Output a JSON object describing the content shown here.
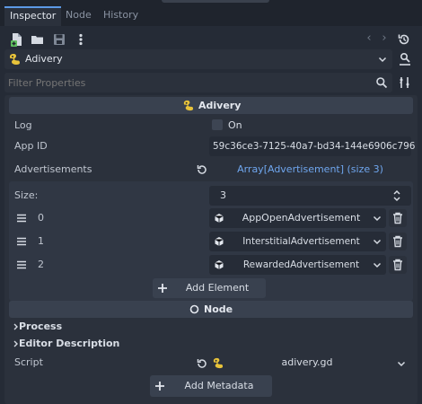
{
  "tabs": [
    {
      "label": "Inspector",
      "active": true
    },
    {
      "label": "Node",
      "active": false
    },
    {
      "label": "History",
      "active": false
    }
  ],
  "object_selector": {
    "name": "Adivery"
  },
  "filter": {
    "placeholder": "Filter Properties"
  },
  "class_header": {
    "label": "Adivery"
  },
  "properties": {
    "log": {
      "label": "Log",
      "checkbox_label": "On",
      "checked": false
    },
    "app_id": {
      "label": "App ID",
      "value": "59c36ce3-7125-40a7-bd34-144e6906c796"
    },
    "advertisements": {
      "label": "Advertisements",
      "value": "Array[Advertisement] (size 3)"
    },
    "size": {
      "label": "Size:",
      "value": "3"
    },
    "items": [
      {
        "index": "0",
        "value": "AppOpenAdvertisement"
      },
      {
        "index": "1",
        "value": "InterstitialAdvertisement"
      },
      {
        "index": "2",
        "value": "RewardedAdvertisement"
      }
    ],
    "add_element_label": "Add Element"
  },
  "node_header": {
    "label": "Node"
  },
  "process_section": {
    "label": "Process"
  },
  "editor_description_section": {
    "label": "Editor Description"
  },
  "script": {
    "label": "Script",
    "value": "adivery.gd"
  },
  "add_metadata_label": "Add Metadata",
  "colors": {
    "accent": "#5c9ae6",
    "link": "#6fa6ee",
    "script_icon": "#e8c33a",
    "background": "#252b36"
  }
}
